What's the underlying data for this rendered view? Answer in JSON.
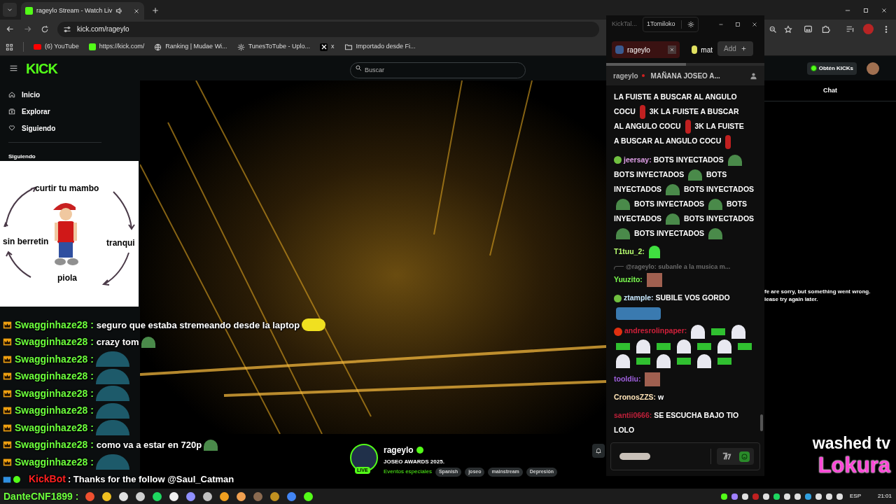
{
  "browser": {
    "tabs": [
      {
        "title": "rageylo Stream - Watch Liv",
        "selected": true
      }
    ],
    "url": "kick.com/rageylo",
    "bookmarks": [
      {
        "label": "(6) YouTube",
        "kind": "youtube"
      },
      {
        "label": "https://kick.com/",
        "kind": "kick"
      },
      {
        "label": "Ranking | Mudae Wi...",
        "kind": "globe"
      },
      {
        "label": "TunesToTube - Uplo...",
        "kind": "gear"
      },
      {
        "label": "x",
        "kind": "x"
      },
      {
        "label": "Importado desde Fi...",
        "kind": "folder"
      }
    ]
  },
  "kick": {
    "logo": "KICK",
    "search": {
      "placeholder": "Buscar"
    },
    "nav": [
      {
        "label": "Inicio",
        "kind": "home"
      },
      {
        "label": "Explorar",
        "kind": "browse"
      },
      {
        "label": "Siguiendo",
        "kind": "heart"
      }
    ],
    "following_heading": "Siguiendo",
    "get_kicks": "Obtén KICKs",
    "chat_tab": "Chat",
    "chat_error": [
      "fe are sorry, but something went wrong.",
      "lease try again later."
    ],
    "stream": {
      "channel": "rageylo",
      "live_badge": "LIVE",
      "title": "JOSEO AWARDS 2025.",
      "category": "Eventos especiales",
      "tags": [
        "Spanish",
        "joseo",
        "mainstream",
        "Depresión"
      ]
    }
  },
  "meme_overlay": {
    "labels": [
      "curtir tu mambo",
      "tranqui",
      "piola",
      "sin berretin"
    ]
  },
  "overlay_chat": [
    {
      "kind": "user",
      "user": "Swagginhaze28 :",
      "text": "seguro que estaba stremeando desde la laptop",
      "emote": {
        "kind": "duck"
      }
    },
    {
      "kind": "user",
      "user": "Swagginhaze28 :",
      "text": "crazy tom",
      "emote": {
        "kind": "frog"
      }
    },
    {
      "kind": "user",
      "user": "Swagginhaze28 :",
      "emote": {
        "kind": "blob"
      }
    },
    {
      "kind": "user",
      "user": "Swagginhaze28 :",
      "emote": {
        "kind": "blob"
      }
    },
    {
      "kind": "user",
      "user": "Swagginhaze28 :",
      "emote": {
        "kind": "blob"
      }
    },
    {
      "kind": "user",
      "user": "Swagginhaze28 :",
      "emote": {
        "kind": "blob"
      }
    },
    {
      "kind": "user",
      "user": "Swagginhaze28 :",
      "emote": {
        "kind": "blob"
      }
    },
    {
      "kind": "user",
      "user": "Swagginhaze28 :",
      "text": "como va a estar en 720p",
      "emote": {
        "kind": "frog"
      }
    },
    {
      "kind": "user",
      "user": "Swagginhaze28 :",
      "emote": {
        "kind": "blob"
      }
    },
    {
      "kind": "bot",
      "user": "KickBot",
      "text": ": Thanks for the follow @Saul_Catman"
    }
  ],
  "overlay_footer_user": "DanteCNF1899 :",
  "overlay_brand": [
    "washed tv",
    "Lokura"
  ],
  "kicktalk": {
    "title": "KickTal...",
    "account": "1Tomiloko",
    "tabs": [
      {
        "label": "rageylo",
        "selected": true
      },
      {
        "label": "mat",
        "selected": false
      }
    ],
    "add_button": "Add",
    "pinned": {
      "user": "rageylo",
      "text": "MAÑANA JOSEO A..."
    },
    "messages": [
      {
        "kind": "message",
        "parts": [
          {
            "kind": "text",
            "text": "LA FUISTE A BUSCAR AL ANGULO"
          },
          {
            "kind": "text",
            "text": "COCU"
          },
          {
            "kind": "dancer"
          },
          {
            "kind": "text",
            "text": "3K LA FUISTE A BUSCAR"
          },
          {
            "kind": "text",
            "text": "AL ANGULO COCU"
          },
          {
            "kind": "dancer"
          },
          {
            "kind": "text",
            "text": "3K LA FUISTE"
          },
          {
            "kind": "text",
            "text": "A BUSCAR AL ANGULO COCU"
          },
          {
            "kind": "dancer"
          }
        ]
      },
      {
        "kind": "message",
        "badge": {
          "kind": "alien"
        },
        "user": "jeersay:",
        "color": "#e0a0e8",
        "parts": [
          {
            "kind": "text",
            "text": "BOTS INYECTADOS"
          },
          {
            "kind": "frog"
          },
          {
            "kind": "text",
            "text": "BOTS INYECTADOS"
          },
          {
            "kind": "frog"
          },
          {
            "kind": "text",
            "text": "BOTS"
          },
          {
            "kind": "text",
            "text": "INYECTADOS"
          },
          {
            "kind": "frog"
          },
          {
            "kind": "text",
            "text": "BOTS INYECTADOS"
          },
          {
            "kind": "frog"
          },
          {
            "kind": "text",
            "text": "BOTS INYECTADOS"
          },
          {
            "kind": "frog"
          },
          {
            "kind": "text",
            "text": "BOTS"
          },
          {
            "kind": "text",
            "text": "INYECTADOS"
          },
          {
            "kind": "frog"
          },
          {
            "kind": "text",
            "text": "BOTS INYECTADOS"
          },
          {
            "kind": "frog"
          },
          {
            "kind": "text",
            "text": "BOTS INYECTADOS"
          },
          {
            "kind": "frog"
          }
        ]
      },
      {
        "kind": "message",
        "user": "T1tuu_2:",
        "color": "#b8ff70",
        "parts": [
          {
            "kind": "ghost"
          }
        ]
      },
      {
        "kind": "reply",
        "text": "@rageylo: subanle a la musica m..."
      },
      {
        "kind": "message",
        "user": "Yuuzito:",
        "color": "#7cff50",
        "parts": [
          {
            "kind": "photo"
          }
        ]
      },
      {
        "kind": "message",
        "badge": {
          "kind": "alien"
        },
        "user": "ztample:",
        "color": "#c8e8ff",
        "parts": [
          {
            "kind": "text",
            "text": "SUBILE VOS GORDO"
          },
          {
            "kind": "cars"
          }
        ]
      },
      {
        "kind": "message",
        "badge": {
          "kind": "flame"
        },
        "user": "andresrolinpaper:",
        "color": "#d0203a",
        "parts": [
          {
            "kind": "anime"
          },
          {
            "kind": "bars"
          },
          {
            "kind": "anime"
          },
          {
            "kind": "bars"
          },
          {
            "kind": "anime"
          },
          {
            "kind": "bars"
          },
          {
            "kind": "anime"
          },
          {
            "kind": "bars"
          },
          {
            "kind": "anime"
          },
          {
            "kind": "bars"
          },
          {
            "kind": "anime"
          },
          {
            "kind": "bars"
          },
          {
            "kind": "anime"
          },
          {
            "kind": "bars"
          },
          {
            "kind": "anime"
          },
          {
            "kind": "bars"
          }
        ]
      },
      {
        "kind": "message",
        "user": "tooldiu:",
        "color": "#a060e0",
        "parts": [
          {
            "kind": "photo"
          }
        ]
      },
      {
        "kind": "message",
        "user": "CronosZZS:",
        "color": "#ffe4b8",
        "parts": [
          {
            "kind": "text",
            "text": "w"
          }
        ]
      },
      {
        "kind": "message",
        "user": "santii0666:",
        "color": "#c0203a",
        "parts": [
          {
            "kind": "text",
            "text": "SE ESCUCHA BAJO TIO"
          },
          {
            "kind": "text",
            "text": "LOLO"
          }
        ]
      }
    ]
  },
  "taskbar": {
    "language": "ESP",
    "time": "21:01"
  }
}
